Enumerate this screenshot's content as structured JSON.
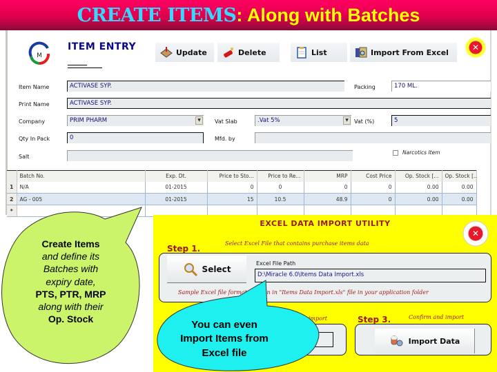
{
  "banner": {
    "title_part1": "CREATE ITEMS",
    "title_part2": ": Along with Batches"
  },
  "item_entry": {
    "title": "ITEM ENTRY",
    "toolbar": {
      "update_label": "Update",
      "delete_label": "Delete",
      "list_label": "List",
      "import_label": "Import From Excel"
    },
    "fields": {
      "item_name_label": "Item Name",
      "item_name_value": "ACTIVASE SYP.",
      "packing_label": "Packing",
      "packing_value": "170 ML.",
      "print_name_label": "Print Name",
      "print_name_value": "ACTIVASE SYP.",
      "company_label": "Company",
      "company_value": "PRIM PHARM",
      "vat_slab_label": "Vat Slab",
      "vat_slab_value": ".Vat 5%",
      "vat_pct_label": "Vat (%)",
      "vat_pct_value": "5",
      "qty_in_pack_label": "Qty In Pack",
      "qty_in_pack_value": "0",
      "mfd_by_label": "Mfd. by",
      "mfd_by_value": "",
      "salt_label": "Salt",
      "salt_value": "",
      "narcotics_label": "Narcotics Item",
      "narcotics_checked": false
    },
    "batch_grid": {
      "columns": [
        "Batch No.",
        "Exp. Dt.",
        "Price to Sto...",
        "Price to Re...",
        "MRP",
        "Cost Price",
        "Op. Stock [...",
        "Op. Stock [..."
      ],
      "rows": [
        {
          "index": "1",
          "cells": [
            "N/A",
            "01-2015",
            "0",
            "0",
            "0",
            "0",
            "0.00",
            "0.00"
          ]
        },
        {
          "index": "2",
          "cells": [
            "AG - 005",
            "01-2015",
            "15",
            "10.5",
            "48.9",
            "0",
            "0.00",
            "0.00"
          ]
        },
        {
          "index": "*",
          "cells": [
            "",
            "",
            "",
            "",
            "",
            "",
            "",
            ""
          ]
        }
      ]
    }
  },
  "import_utility": {
    "title": "EXCEL DATA IMPORT UTILITY",
    "step1_label": "Step 1.",
    "step1_hint": "Select Excel File that contains purchase items data",
    "select_button": "Select",
    "file_path_label": "Excel File Path",
    "file_path_value": "D:\\Miracle 6.0\\Items Data Import.xls",
    "sample_note": "Sample Excel file format is given in \"Items Data Import.xls\" file in your application folder",
    "step2_hint_visible": "...s to import",
    "step3_label": "Step 3.",
    "step3_hint": "Confirm and import",
    "import_button": "Import Data"
  },
  "callouts": {
    "green": {
      "line1": "Create Items",
      "line2": "and define its",
      "line3": "Batches with",
      "line4": "expiry date,",
      "line5": "PTS, PTR, MRP",
      "line6": "along with their",
      "line7": "Op. Stock"
    },
    "cyan": {
      "line1": "You can even",
      "line2": "Import Items from",
      "line3": "Excel file"
    }
  },
  "colors": {
    "banner_bg": "#e0004e",
    "banner_cyan": "#35d9ff",
    "banner_yellow": "#ffff00",
    "import_panel_bg": "#ffff00",
    "callout_green": "#ccf46a",
    "callout_cyan": "#1ef0f0",
    "step_red": "#a01818"
  }
}
